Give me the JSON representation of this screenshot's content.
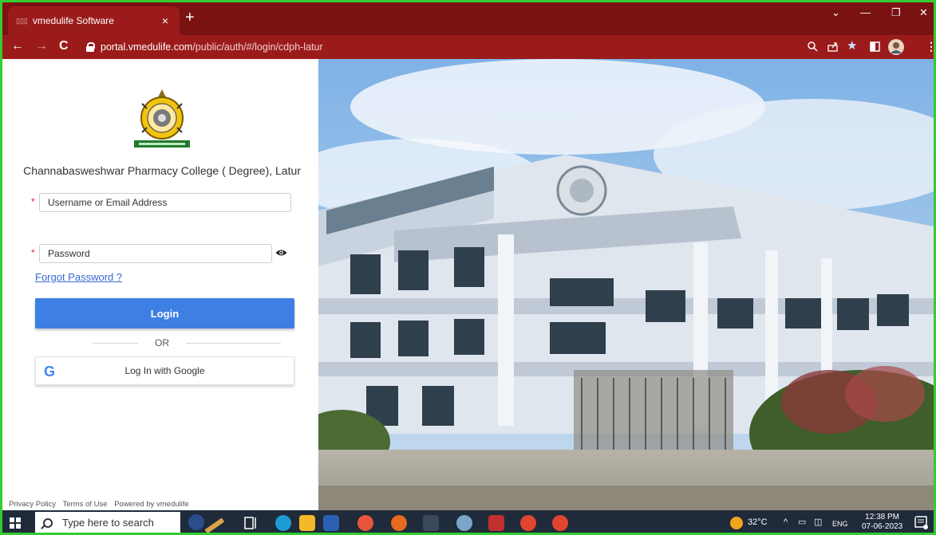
{
  "browser": {
    "tab_title": "vmedulife Software",
    "tab_close": "×",
    "new_tab": "+",
    "url_domain": "portal.vmedulife.com",
    "url_path": "/public/auth/#/login/cdph-latur"
  },
  "college": {
    "name": "Channabasweshwar Pharmacy College ( Degree), Latur"
  },
  "form": {
    "required_mark": "*",
    "username_placeholder": "Username or Email Address",
    "password_placeholder": "Password",
    "forgot_label": "Forgot Password ?",
    "login_label": "Login",
    "or_label": "OR",
    "google_icon": "G",
    "google_label": "Log In with Google"
  },
  "footer": {
    "privacy": "Privacy Policy",
    "terms": "Terms of Use",
    "powered": "Powered by vmedulife"
  },
  "taskbar": {
    "search_placeholder": "Type here to search",
    "temperature": "32°C",
    "language": "ENG",
    "time": "12:38 PM",
    "date": "07-06-2023"
  },
  "colors": {
    "browser_frame": "#9b1b1b",
    "login_button": "#3d7fe3",
    "link": "#3a66d6",
    "taskbar": "#1f2a3a"
  }
}
